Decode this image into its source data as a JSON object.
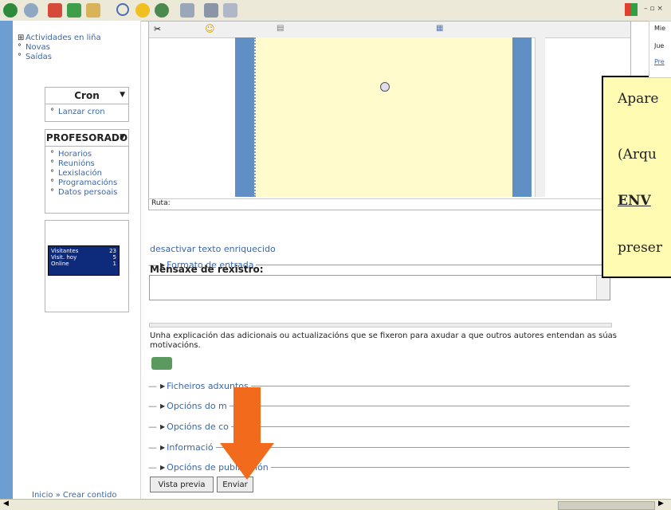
{
  "sidebar": {
    "top_items": [
      "Actividades en liña",
      "Novas",
      "Saídas"
    ],
    "cron_block": {
      "title": "Cron",
      "items": [
        "Lanzar cron"
      ]
    },
    "profesorado_block": {
      "title": "PROFESORADO",
      "items": [
        "Horarios",
        "Reunións",
        "Lexislación",
        "Programacións",
        "Datos persoais"
      ]
    },
    "counter": {
      "rows": [
        {
          "label": "Visitantes",
          "value": "23"
        },
        {
          "label": "Visit. hoy",
          "value": "5"
        },
        {
          "label": "Online",
          "value": "1"
        }
      ]
    },
    "bottom_link": "Inicio » Crear contido"
  },
  "editor": {
    "path_label": "Ruta:"
  },
  "form": {
    "disable_rich_text": "desactivar texto enriquecido",
    "input_format": "Formato de entrada",
    "log_message_label": "Mensaxe de rexistro:",
    "description": "Unha explicación das adicionais ou actualizacións que se fixeron para axudar a que outros autores entendan as súas motivacións.",
    "sections": [
      "Ficheiros adxuntos",
      "Opcións do m",
      "Opcións de co",
      "Informació",
      "Opcións de publicación"
    ],
    "preview_button": "Vista previa",
    "submit_button": "Enviar"
  },
  "callout": {
    "lines": [
      "Apare",
      "(Arqu",
      "ENV",
      "preser"
    ]
  },
  "right_panel": {
    "items": [
      "Mie",
      "Jue",
      "Pre"
    ]
  },
  "colors": {
    "arrow": "#f26a1b",
    "callout_bg": "#fffbb3",
    "editor_canvas": "#fffbcd",
    "sidebar_strip": "#6d9ed2"
  }
}
